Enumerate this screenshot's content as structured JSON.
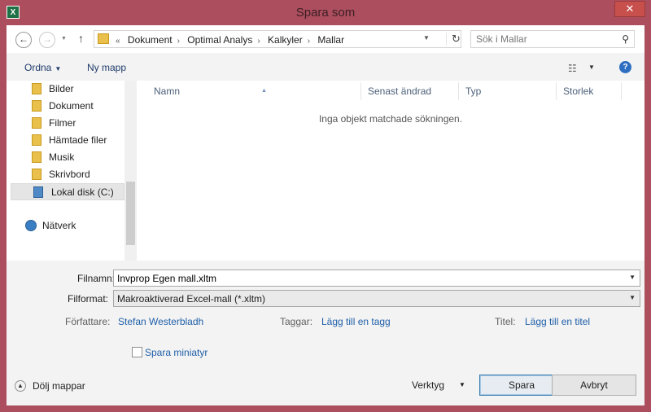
{
  "window": {
    "title": "Spara som",
    "app_icon_letter": "X",
    "close_glyph": "✕"
  },
  "navigation": {
    "back_glyph": "←",
    "forward_glyph": "→",
    "up_glyph": "↑",
    "breadcrumb_prefix": "«",
    "breadcrumbs": [
      "Dokument",
      "Optimal Analys",
      "Kalkyler",
      "Mallar"
    ],
    "search_placeholder": "Sök i Mallar"
  },
  "toolbar": {
    "organize_label": "Ordna",
    "new_folder_label": "Ny mapp"
  },
  "sidebar": {
    "items": [
      {
        "label": "Bilder"
      },
      {
        "label": "Dokument"
      },
      {
        "label": "Filmer"
      },
      {
        "label": "Hämtade filer"
      },
      {
        "label": "Musik"
      },
      {
        "label": "Skrivbord"
      },
      {
        "label": "Lokal disk (C:)"
      },
      {
        "label": "Nätverk"
      }
    ]
  },
  "file_list": {
    "columns": [
      "Namn",
      "Senast ändrad",
      "Typ",
      "Storlek"
    ],
    "empty_message": "Inga objekt matchade sökningen."
  },
  "form": {
    "filename_label": "Filnamn:",
    "filename_value": "Invprop Egen mall.xltm",
    "filetype_label": "Filformat:",
    "filetype_value": "Makroaktiverad Excel-mall (*.xltm)",
    "authors_label": "Författare:",
    "authors_value": "Stefan Westerbladh",
    "tags_label": "Taggar:",
    "tags_value": "Lägg till en tagg",
    "title_label": "Titel:",
    "title_value": "Lägg till en titel",
    "thumbnail_label": "Spara miniatyr"
  },
  "footer": {
    "hide_folders_label": "Dölj mappar",
    "tools_label": "Verktyg",
    "save_label": "Spara",
    "cancel_label": "Avbryt"
  },
  "colors": {
    "window_frame": "#ac4e5e",
    "link": "#1f5fa8",
    "primary_border": "#3c7fb1"
  }
}
